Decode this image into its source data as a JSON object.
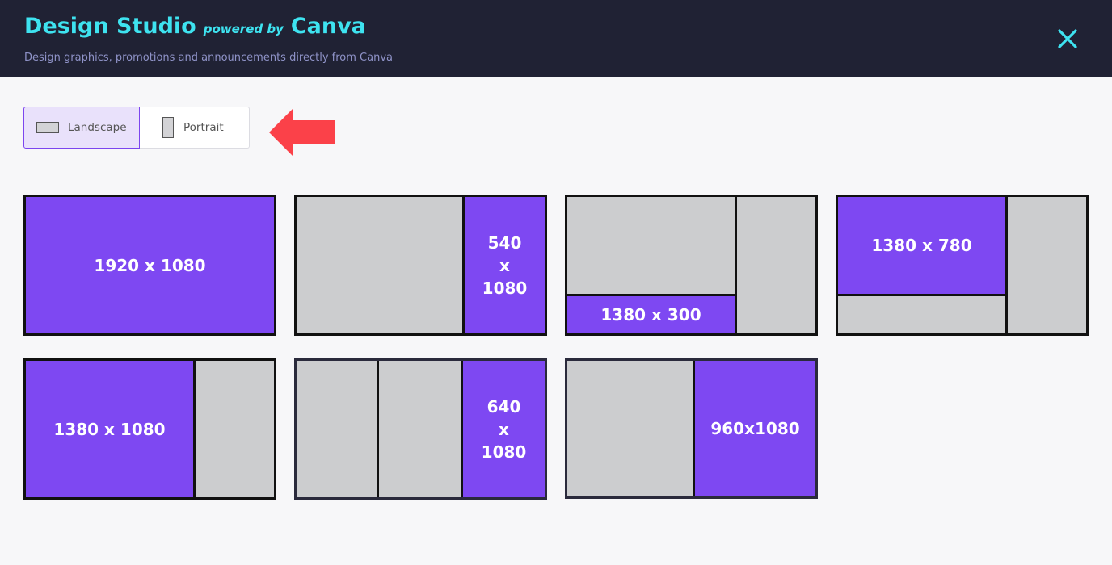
{
  "header": {
    "title": "Design Studio",
    "powered_by": "powered by",
    "brand": "Canva",
    "subtitle": "Design graphics, promotions and announcements directly from Canva",
    "accent_color": "#3ee3f0",
    "close_icon": "close-icon"
  },
  "orientation": {
    "selected": "Landscape",
    "options": [
      {
        "label": "Landscape",
        "icon": "landscape-rect-icon"
      },
      {
        "label": "Portrait",
        "icon": "portrait-rect-icon"
      }
    ],
    "pointer_icon": "red-arrow-left-icon"
  },
  "templates": [
    {
      "label": "1920 x 1080"
    },
    {
      "label": "540\nx\n1080"
    },
    {
      "label": "1380 x 300"
    },
    {
      "label": "1380 x 780"
    },
    {
      "label": "1380 x 1080"
    },
    {
      "label": "640\nx\n1080"
    },
    {
      "label": "960x1080"
    }
  ],
  "colors": {
    "header_bg": "#202234",
    "highlight": "#7e48f2",
    "placeholder": "#cccdcf",
    "arrow": "#fb4149"
  }
}
